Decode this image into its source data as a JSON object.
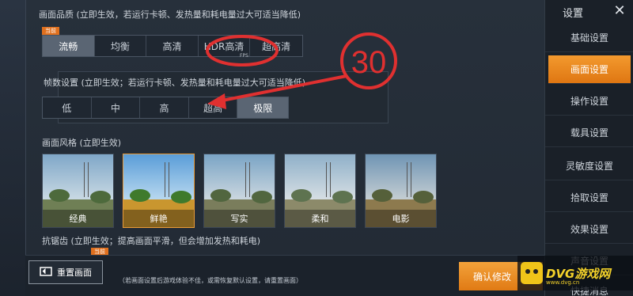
{
  "quality": {
    "label": "画面品质 (立即生效，若运行卡顿、发热量和耗电量过大可适当降低)",
    "tag": "当前",
    "options": [
      "流畅",
      "均衡",
      "高清",
      "HDR高清",
      "超高清"
    ],
    "hdr_sub": "FPS",
    "selected": "流畅"
  },
  "fps": {
    "label": "帧数设置 (立即生效；若运行卡顿、发热量和耗电量过大可适当降低)",
    "options": [
      "低",
      "中",
      "高",
      "超高",
      "极限"
    ],
    "selected": "极限"
  },
  "annotation": {
    "number": "30",
    "circle_color": "#e03030"
  },
  "style": {
    "label": "画面风格 (立即生效)",
    "tag": "当前",
    "items": [
      "经典",
      "鲜艳",
      "写实",
      "柔和",
      "电影"
    ],
    "selected": "鲜艳"
  },
  "antialias": {
    "label": "抗锯齿 (立即生效；提高画面平滑，但会增加发热和耗电)",
    "tag": "当前"
  },
  "bottom": {
    "reset_label": "重置画面",
    "hint": "（若画面设置后游戏体验不佳，或需恢复默认设置，请重置画面）",
    "confirm_label": "确认修改"
  },
  "sidebar": {
    "title": "设置",
    "close": "✕",
    "items": [
      "基础设置",
      "画面设置",
      "操作设置",
      "载具设置",
      "灵敏度设置",
      "拾取设置",
      "效果设置",
      "声音设置",
      "快捷消息"
    ],
    "active": "画面设置"
  },
  "watermark": {
    "brand": "DVG游戏网",
    "url": "www.dvg.cn"
  },
  "colors": {
    "accent": "#e98a24",
    "annotation": "#e03030"
  }
}
